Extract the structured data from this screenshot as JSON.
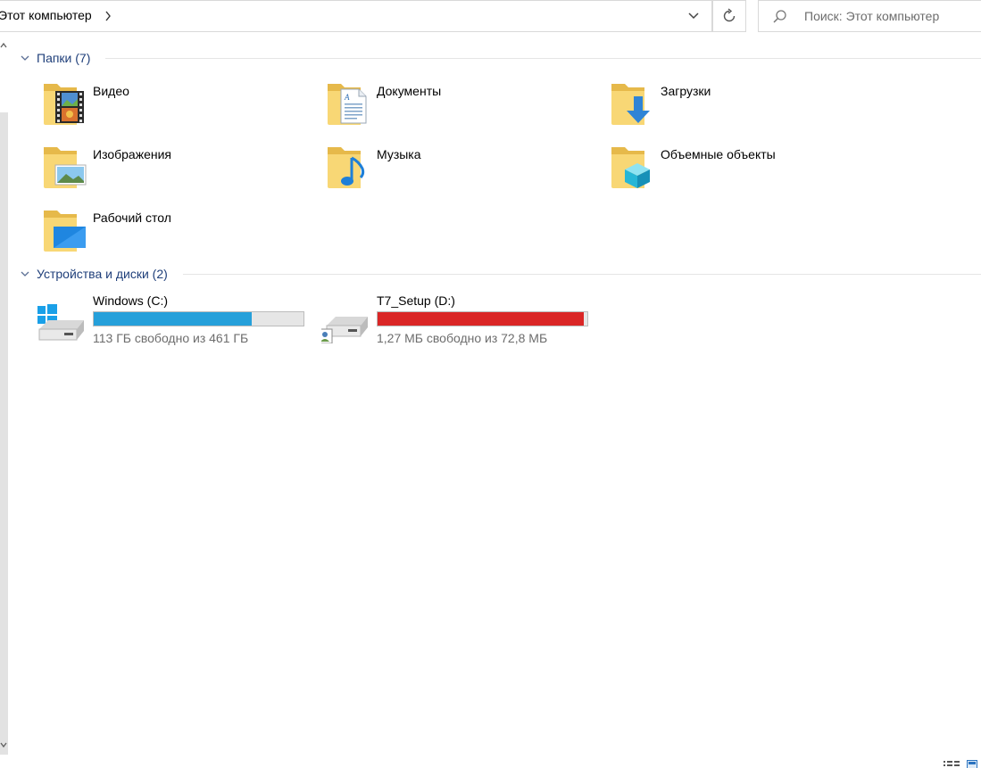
{
  "address_bar": {
    "path_label": "Этот компьютер",
    "search_placeholder": "Поиск: Этот компьютер"
  },
  "groups": [
    {
      "title": "Папки (7)"
    },
    {
      "title": "Устройства и диски (2)"
    }
  ],
  "folders": [
    {
      "label": "Видео",
      "icon": "video-folder-icon"
    },
    {
      "label": "Документы",
      "icon": "documents-folder-icon"
    },
    {
      "label": "Загрузки",
      "icon": "downloads-folder-icon"
    },
    {
      "label": "Изображения",
      "icon": "pictures-folder-icon"
    },
    {
      "label": "Музыка",
      "icon": "music-folder-icon"
    },
    {
      "label": "Объемные объекты",
      "icon": "3d-objects-folder-icon"
    },
    {
      "label": "Рабочий стол",
      "icon": "desktop-folder-icon"
    }
  ],
  "drives": [
    {
      "label": "Windows (C:)",
      "free_text": "113 ГБ свободно из 461 ГБ",
      "used_fraction": 0.755,
      "bar_color": "#26a0da",
      "icon": "windows-drive-icon"
    },
    {
      "label": "T7_Setup (D:)",
      "free_text": "1,27 МБ свободно из 72,8 МБ",
      "used_fraction": 0.983,
      "bar_color": "#da2626",
      "icon": "network-drive-icon"
    }
  ],
  "colors": {
    "group_title": "#1f3f7a",
    "folder_yellow": "#f8d775",
    "folder_back": "#e6b94a"
  }
}
